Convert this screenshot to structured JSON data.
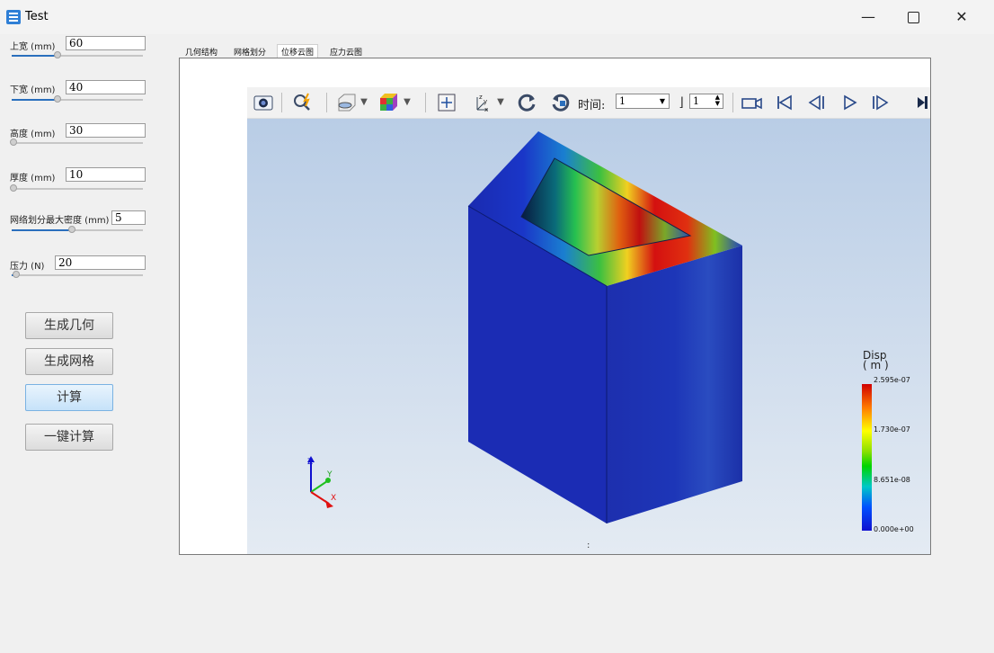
{
  "window": {
    "title": "Test",
    "min_glyph": "—",
    "close_glyph": "✕"
  },
  "params": [
    {
      "label": "上宽 (mm)",
      "value": "60",
      "fill": 0.45
    },
    {
      "label": "下宽 (mm)",
      "value": "40",
      "fill": 0.45
    },
    {
      "label": "高度 (mm)",
      "value": "30",
      "fill": 0.0
    },
    {
      "label": "厚度 (mm)",
      "value": "10",
      "fill": 0.0
    },
    {
      "label": "网络划分最大密度 (mm)",
      "value": "5",
      "fill": 0.45
    },
    {
      "label": "压力 (N)",
      "value": "20",
      "fill": 0.02
    }
  ],
  "buttons": {
    "geometry": "生成几何",
    "mesh": "生成网格",
    "compute": "计算",
    "one_click": "一键计算"
  },
  "tabs": [
    "几何结构",
    "网格划分",
    "位移云图",
    "应力云图"
  ],
  "selected_tab": "位移云图",
  "toolbar": {
    "time_label": "时间:",
    "time_value": "1",
    "step_value": "1"
  },
  "legend": {
    "title": "Disp",
    "unit": "( m )",
    "ticks": [
      "2.595e-07",
      "1.730e-07",
      "8.651e-08",
      "0.000e+00"
    ]
  },
  "axes": {
    "x": "X",
    "y": "Y",
    "z": "Z"
  },
  "footer_mark": ":",
  "colors": {
    "accent": "#2a6fbd",
    "mesh_blue": "#1b2fb0"
  }
}
